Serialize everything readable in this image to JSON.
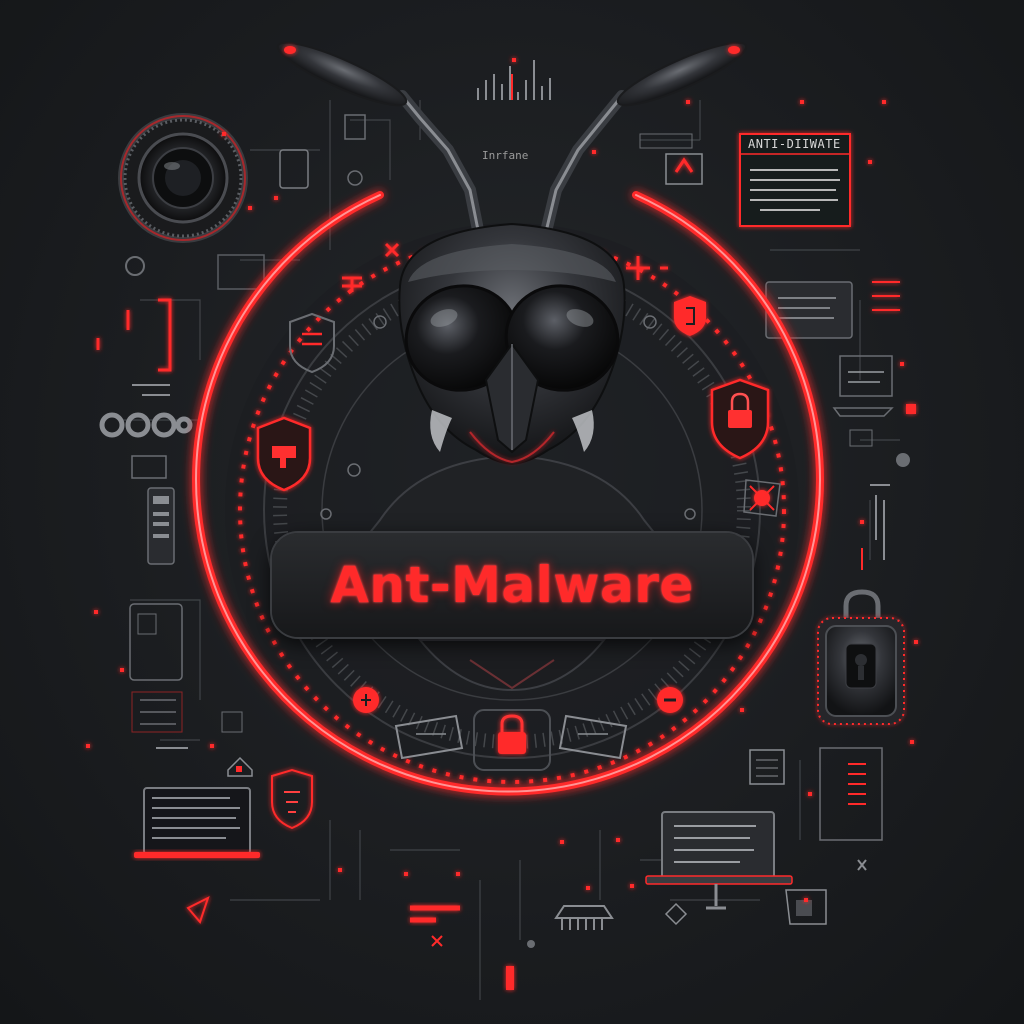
{
  "title": "Ant-Malware",
  "panel_title": "ANTI-DIIWATE",
  "tag_label": "Inrfane",
  "colors": {
    "background": "#1b1d20",
    "accent_red": "#ff2a2a",
    "metal": "#3a3d42"
  },
  "icons": [
    "ant-head-icon",
    "shield-icon",
    "padlock-icon",
    "virus-icon",
    "camera-lens-icon",
    "laptop-icon",
    "gear-icon"
  ]
}
